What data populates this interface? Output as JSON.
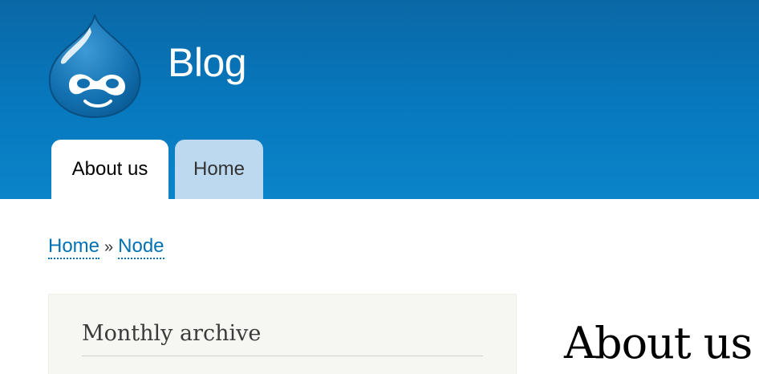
{
  "header": {
    "site_name": "Blog",
    "background_color": "#0779bf",
    "logo_icon": "drupal-drop-icon"
  },
  "tabs": [
    {
      "label": "About us",
      "active": true
    },
    {
      "label": "Home",
      "active": false
    }
  ],
  "breadcrumb": {
    "items": [
      "Home",
      "Node"
    ],
    "separator": "»",
    "link_color": "#0071b3"
  },
  "sidebar": {
    "block_title": "Monthly archive"
  },
  "main": {
    "page_title": "About us"
  }
}
